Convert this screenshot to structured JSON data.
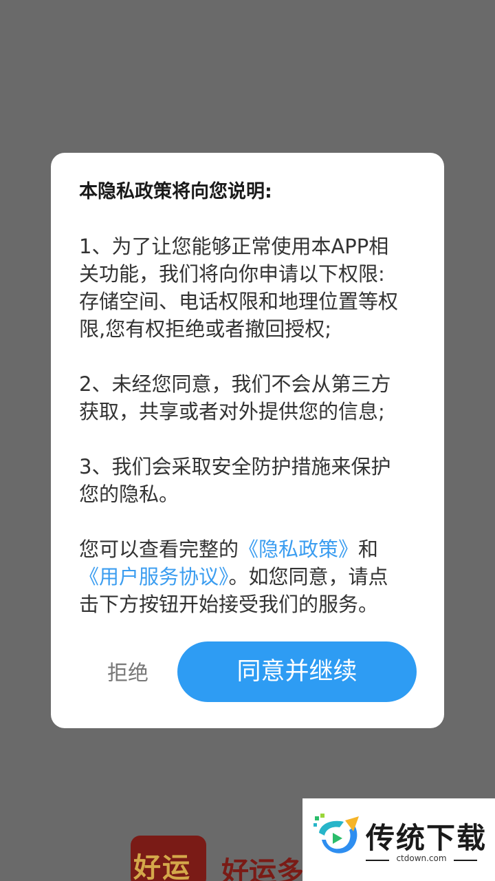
{
  "background_app": {
    "icon_text": "好运",
    "name_partial": "好运多"
  },
  "dialog": {
    "title": "本隐私政策将向您说明:",
    "paragraph1": {
      "line1": "1、为了让您能够正常使用本APP相",
      "line2": "关功能，我们将向你申请以下权限:",
      "line3": "存储空间、电话权限和地理位置等权",
      "line4": "限,您有权拒绝或者撤回授权;"
    },
    "paragraph2": {
      "line1": "2、未经您同意，我们不会从第三方",
      "line2": "获取，共享或者对外提供您的信息;"
    },
    "paragraph3": {
      "line1": "3、我们会采取安全防护措施来保护",
      "line2": "您的隐私。"
    },
    "paragraph4": {
      "prefix": "您可以查看完整的",
      "privacy_link": "《隐私政策》",
      "and": "和",
      "service_link": "《用户服务协议》",
      "suffix": "。如您同意，请点",
      "line3": "击下方按钮开始接受我们的服务。"
    },
    "reject_label": "拒绝",
    "agree_label": "同意并继续"
  },
  "watermark": {
    "name": "传统下载",
    "url": "ctdown.com"
  },
  "colors": {
    "overlay": "#6a6a6a",
    "accent": "#2e9cf3",
    "link": "#3b9df0"
  }
}
